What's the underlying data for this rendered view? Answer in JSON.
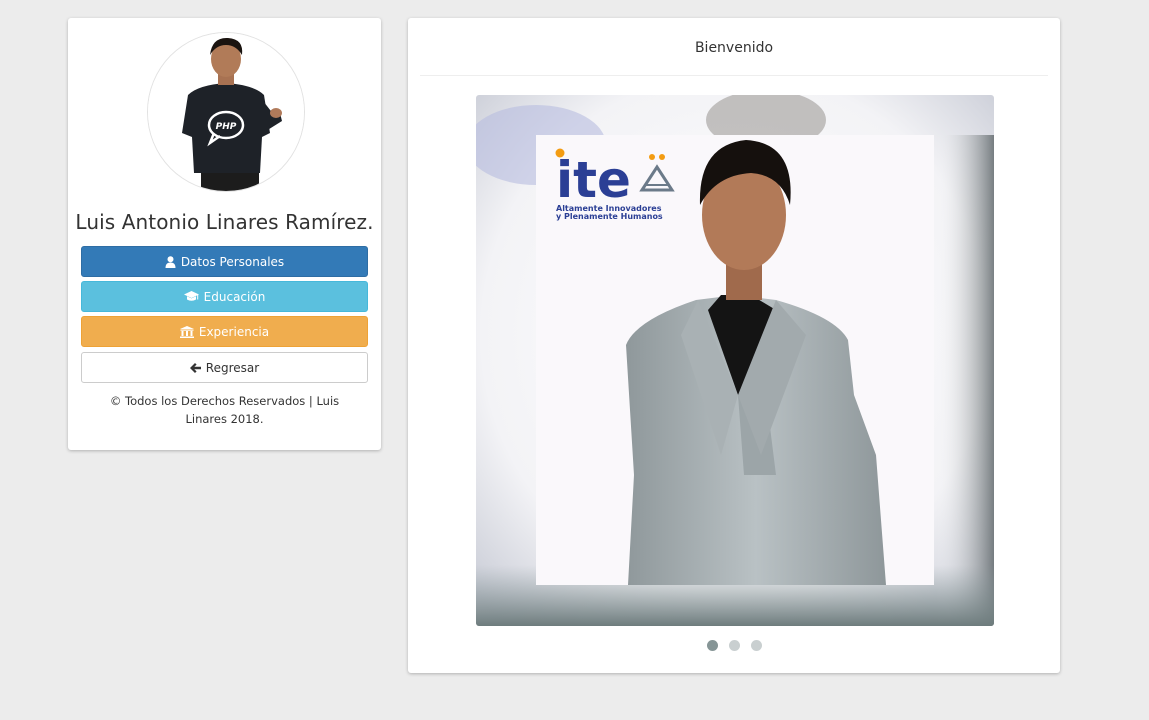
{
  "profile": {
    "name": "Luis Antonio Linares Ramírez.",
    "buttons": {
      "personal": "Datos Personales",
      "education": "Educación",
      "experience": "Experiencia",
      "back": "Regresar"
    },
    "footer": "© Todos los Derechos Reservados | Luis Linares 2018."
  },
  "main": {
    "title": "Bienvenido",
    "slide_logo": {
      "brand": "ite",
      "tagline_line1": "Altamente Innovadores",
      "tagline_line2": "y Plenamente Humanos"
    },
    "shirt_logo": "PHP",
    "carousel": {
      "slide_count": 3,
      "active_index": 0
    }
  },
  "colors": {
    "primary": "#337ab7",
    "info": "#5bc0de",
    "warning": "#f0ad4e",
    "background": "#ececec",
    "logo_blue": "#2b3f95",
    "logo_orange": "#f39c12"
  },
  "icons": {
    "personal": "user-icon",
    "education": "graduation-cap-icon",
    "experience": "bank-icon",
    "back": "arrow-left-icon"
  }
}
